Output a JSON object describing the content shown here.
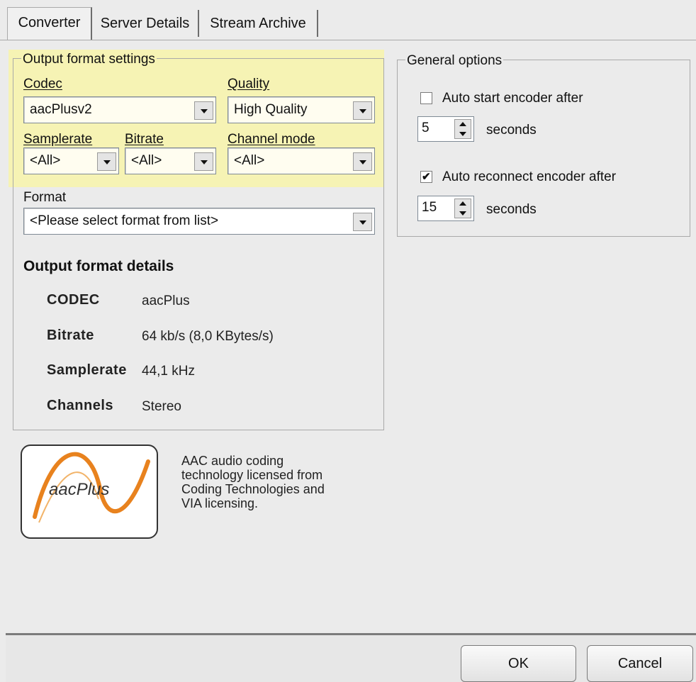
{
  "tabs": [
    {
      "label": "Converter",
      "active": true
    },
    {
      "label": "Server Details",
      "active": false
    },
    {
      "label": "Stream Archive",
      "active": false
    }
  ],
  "output_format_settings": {
    "legend": "Output format settings",
    "codec": {
      "label": "Codec",
      "value": "aacPlusv2"
    },
    "quality": {
      "label": "Quality",
      "value": "High Quality"
    },
    "samplerate": {
      "label": "Samplerate",
      "value": "<All>"
    },
    "bitrate": {
      "label": "Bitrate",
      "value": "<All>"
    },
    "channel_mode": {
      "label": "Channel mode",
      "value": "<All>"
    },
    "highlight_color": "#f6f3b4"
  },
  "format": {
    "label": "Format",
    "value": "<Please select format from list>"
  },
  "details": {
    "heading": "Output format details",
    "rows": [
      {
        "key": "CODEC",
        "value": "aacPlus"
      },
      {
        "key": "Bitrate",
        "value": "64 kb/s (8,0 KBytes/s)"
      },
      {
        "key": "Samplerate",
        "value": "44,1 kHz"
      },
      {
        "key": "Channels",
        "value": "Stereo"
      }
    ]
  },
  "logo": {
    "text": "aacPlus",
    "accent_color": "#e8821e"
  },
  "license_text": "AAC audio coding\ntechnology licensed from\nCoding Technologies and\nVIA licensing.",
  "general_options": {
    "legend": "General options",
    "auto_start": {
      "label": "Auto start encoder after",
      "checked": false,
      "value": "5",
      "unit": "seconds"
    },
    "auto_reconnect": {
      "label": "Auto reconnect encoder after",
      "checked": true,
      "value": "15",
      "unit": "seconds"
    }
  },
  "buttons": {
    "ok": "OK",
    "cancel": "Cancel"
  }
}
